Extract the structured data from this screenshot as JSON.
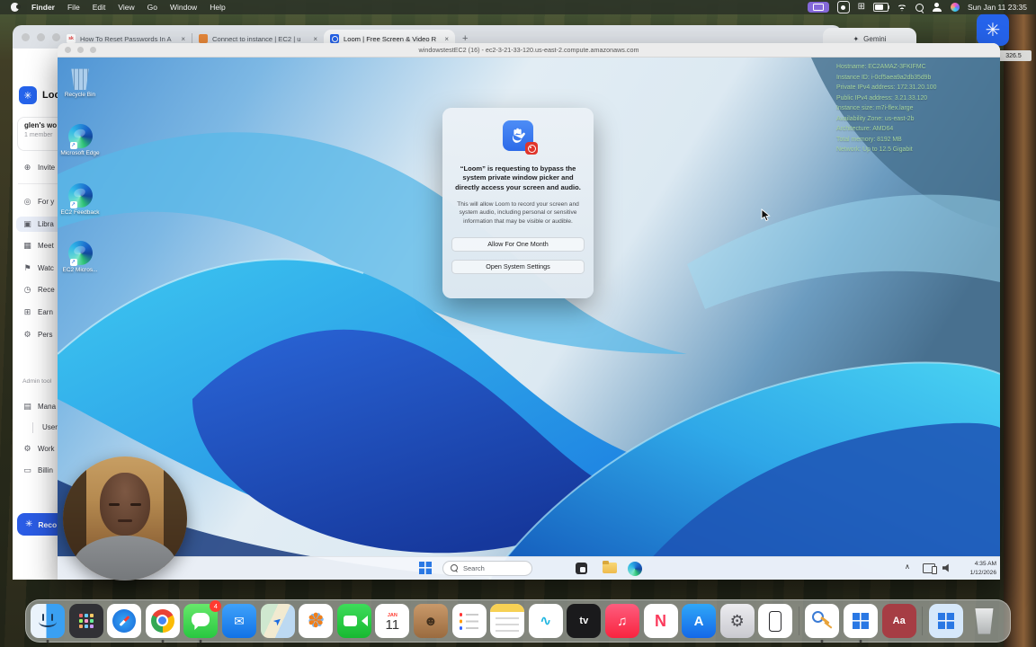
{
  "menu_bar": {
    "items": [
      "Finder",
      "File",
      "Edit",
      "View",
      "Go",
      "Window",
      "Help"
    ],
    "clock": "Sun Jan 11 23:35"
  },
  "browser": {
    "tabs": [
      {
        "favicon": "sk",
        "title": "How To Reset Passwords In A"
      },
      {
        "favicon": "aws",
        "title": "Connect to instance | EC2 | u"
      },
      {
        "favicon": "loom",
        "title": "Loom | Free Screen & Video R"
      }
    ],
    "close_glyph": "×",
    "new_tab_glyph": "+"
  },
  "gemini_tab": {
    "icon": "✦",
    "label": "Gemini"
  },
  "loom_widget": {
    "glyph": "✳",
    "badge": "326.5"
  },
  "sidebar": {
    "logo_glyph": "✳",
    "logo_text": "Loo",
    "workspace": {
      "name": "glen's wo",
      "members": "1 member"
    },
    "items": [
      {
        "glyph": "⊕",
        "label": "Invite"
      },
      {
        "glyph": "◎",
        "label": "For y"
      },
      {
        "glyph": "▣",
        "label": "Libra"
      },
      {
        "glyph": "▦",
        "label": "Meet"
      },
      {
        "glyph": "⚑",
        "label": "Watc"
      },
      {
        "glyph": "◷",
        "label": "Rece"
      },
      {
        "glyph": "⊞",
        "label": "Earn"
      },
      {
        "glyph": "⚙",
        "label": "Pers"
      }
    ],
    "admin_header": "Admin tool",
    "admin_items": [
      {
        "glyph": "▤",
        "label": "Mana"
      },
      {
        "glyph": "",
        "label": "Users"
      },
      {
        "glyph": "⚙",
        "label": "Work"
      },
      {
        "glyph": "▭",
        "label": "Billin"
      }
    ],
    "record_button": {
      "glyph": "✳",
      "label": "Reco"
    }
  },
  "remote_window": {
    "title": "windowstestEC2 (16) - ec2-3-21-33-120.us-east-2.compute.amazonaws.com",
    "ec2_info": [
      "Hostname: EC2AMAZ-3FKIFMC",
      "Instance ID: i-0cf5aea9a2db35d9b",
      "Private IPv4 address: 172.31.20.100",
      "Public IPv4 address: 3.21.33.120",
      "Instance size: m7i-flex.large",
      "Availability Zone: us-east-2b",
      "Architecture: AMD64",
      "Total memory: 8192 MB",
      "Network: Up to 12.5 Gigabit"
    ],
    "desktop_icons": [
      {
        "label": "Recycle Bin"
      },
      {
        "label": "Microsoft Edge"
      },
      {
        "label": "EC2 Feedback"
      },
      {
        "label": "EC2 Micros..."
      }
    ],
    "shortcut_arrow": "↗",
    "dialog": {
      "title": "“Loom” is requesting to bypass the system private window picker and directly access your screen and audio.",
      "body": "This will allow Loom to record your screen and system audio, including personal or sensitive information that may be visible or audible.",
      "buttons": [
        "Allow For One Month",
        "Open System Settings"
      ]
    },
    "taskbar": {
      "search_placeholder": "Search",
      "time": "4:35 AM",
      "date": "1/12/2026",
      "chevron": "∧"
    }
  },
  "dock": {
    "glyphs": {
      "mail": "✉",
      "maps": "➤",
      "photos": "✽",
      "contacts": "☻",
      "freeform": "∿",
      "appletv": "tv",
      "music": "♫",
      "news": "N",
      "appstore": "A",
      "settings": "⚙",
      "dictionary": "Aa"
    },
    "calendar": {
      "month": "JAN",
      "day": "11"
    },
    "badges": {
      "messages": "4"
    }
  },
  "colors": {
    "accent_blue": "#2563eb",
    "record_red": "#e0352b",
    "ec2_text_green": "#a5d49e",
    "windows_taskbar_bg": "#f3f7fb"
  }
}
